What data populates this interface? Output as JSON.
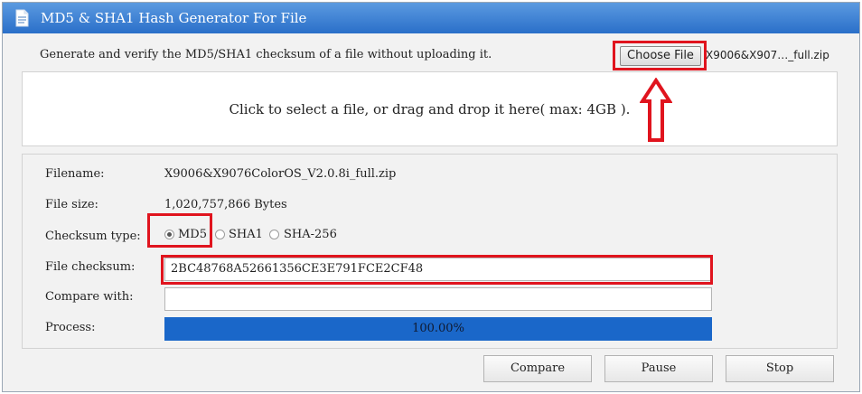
{
  "window": {
    "title": "MD5 & SHA1 Hash Generator For File"
  },
  "header": {
    "intro": "Generate and verify the MD5/SHA1 checksum of a file without uploading it.",
    "choose_file_label": "Choose File",
    "chosen_file_name": "X9006&X907…_full.zip"
  },
  "dropzone": {
    "text": "Click to select a file, or drag and drop it here( max: 4GB )."
  },
  "details": {
    "filename_label": "Filename:",
    "filename_value": "X9006&X9076ColorOS_V2.0.8i_full.zip",
    "filesize_label": "File size:",
    "filesize_value": "1,020,757,866 Bytes",
    "checksum_type_label": "Checksum type:",
    "checksum_types": [
      "MD5",
      "SHA1",
      "SHA-256"
    ],
    "checksum_type_selected": "MD5",
    "file_checksum_label": "File checksum:",
    "file_checksum_value": "2BC48768A52661356CE3E791FCE2CF48",
    "compare_label": "Compare with:",
    "compare_value": "",
    "process_label": "Process:",
    "progress_text": "100.00%",
    "progress_fraction": 1.0
  },
  "actions": {
    "compare": "Compare",
    "pause": "Pause",
    "stop": "Stop"
  },
  "colors": {
    "highlight": "#e0141e",
    "progress": "#1a67c9",
    "titlebar": "#2a6fc9"
  }
}
